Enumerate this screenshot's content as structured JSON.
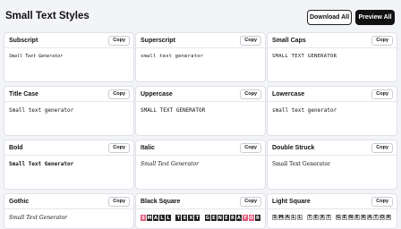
{
  "header": {
    "title": "Small Text Styles",
    "download_label": "Download All",
    "preview_label": "Preview All"
  },
  "cards": [
    {
      "title": "Subscript",
      "copy": "Copy",
      "sample": "Small Text Generator"
    },
    {
      "title": "Superscript",
      "copy": "Copy",
      "sample": "small text generator"
    },
    {
      "title": "Small Caps",
      "copy": "Copy",
      "sample": "SMALL TEXT GENERATOR"
    },
    {
      "title": "Title Case",
      "copy": "Copy",
      "sample": "Small text generator"
    },
    {
      "title": "Uppercase",
      "copy": "Copy",
      "sample": "SMALL TEXT GENERATOR"
    },
    {
      "title": "Lowercase",
      "copy": "Copy",
      "sample": "small text generator"
    },
    {
      "title": "Bold",
      "copy": "Copy",
      "sample": "Small Text Generator"
    },
    {
      "title": "Italic",
      "copy": "Copy",
      "sample": "Small Text Generator"
    },
    {
      "title": "Double Struck",
      "copy": "Copy",
      "sample": "Small Text Generator"
    },
    {
      "title": "Gothic",
      "copy": "Copy",
      "sample": "Small Text Generator"
    },
    {
      "title": "Black Square",
      "copy": "Copy",
      "sample": "SMALL TEXT GENERATOR"
    },
    {
      "title": "Light Square",
      "copy": "Copy",
      "sample": "SMALL TEXT GENERATOR"
    }
  ],
  "colors": {
    "background": "#f3f4f7",
    "primary_button": "#111111",
    "accent_tile": "#e05a7a"
  }
}
